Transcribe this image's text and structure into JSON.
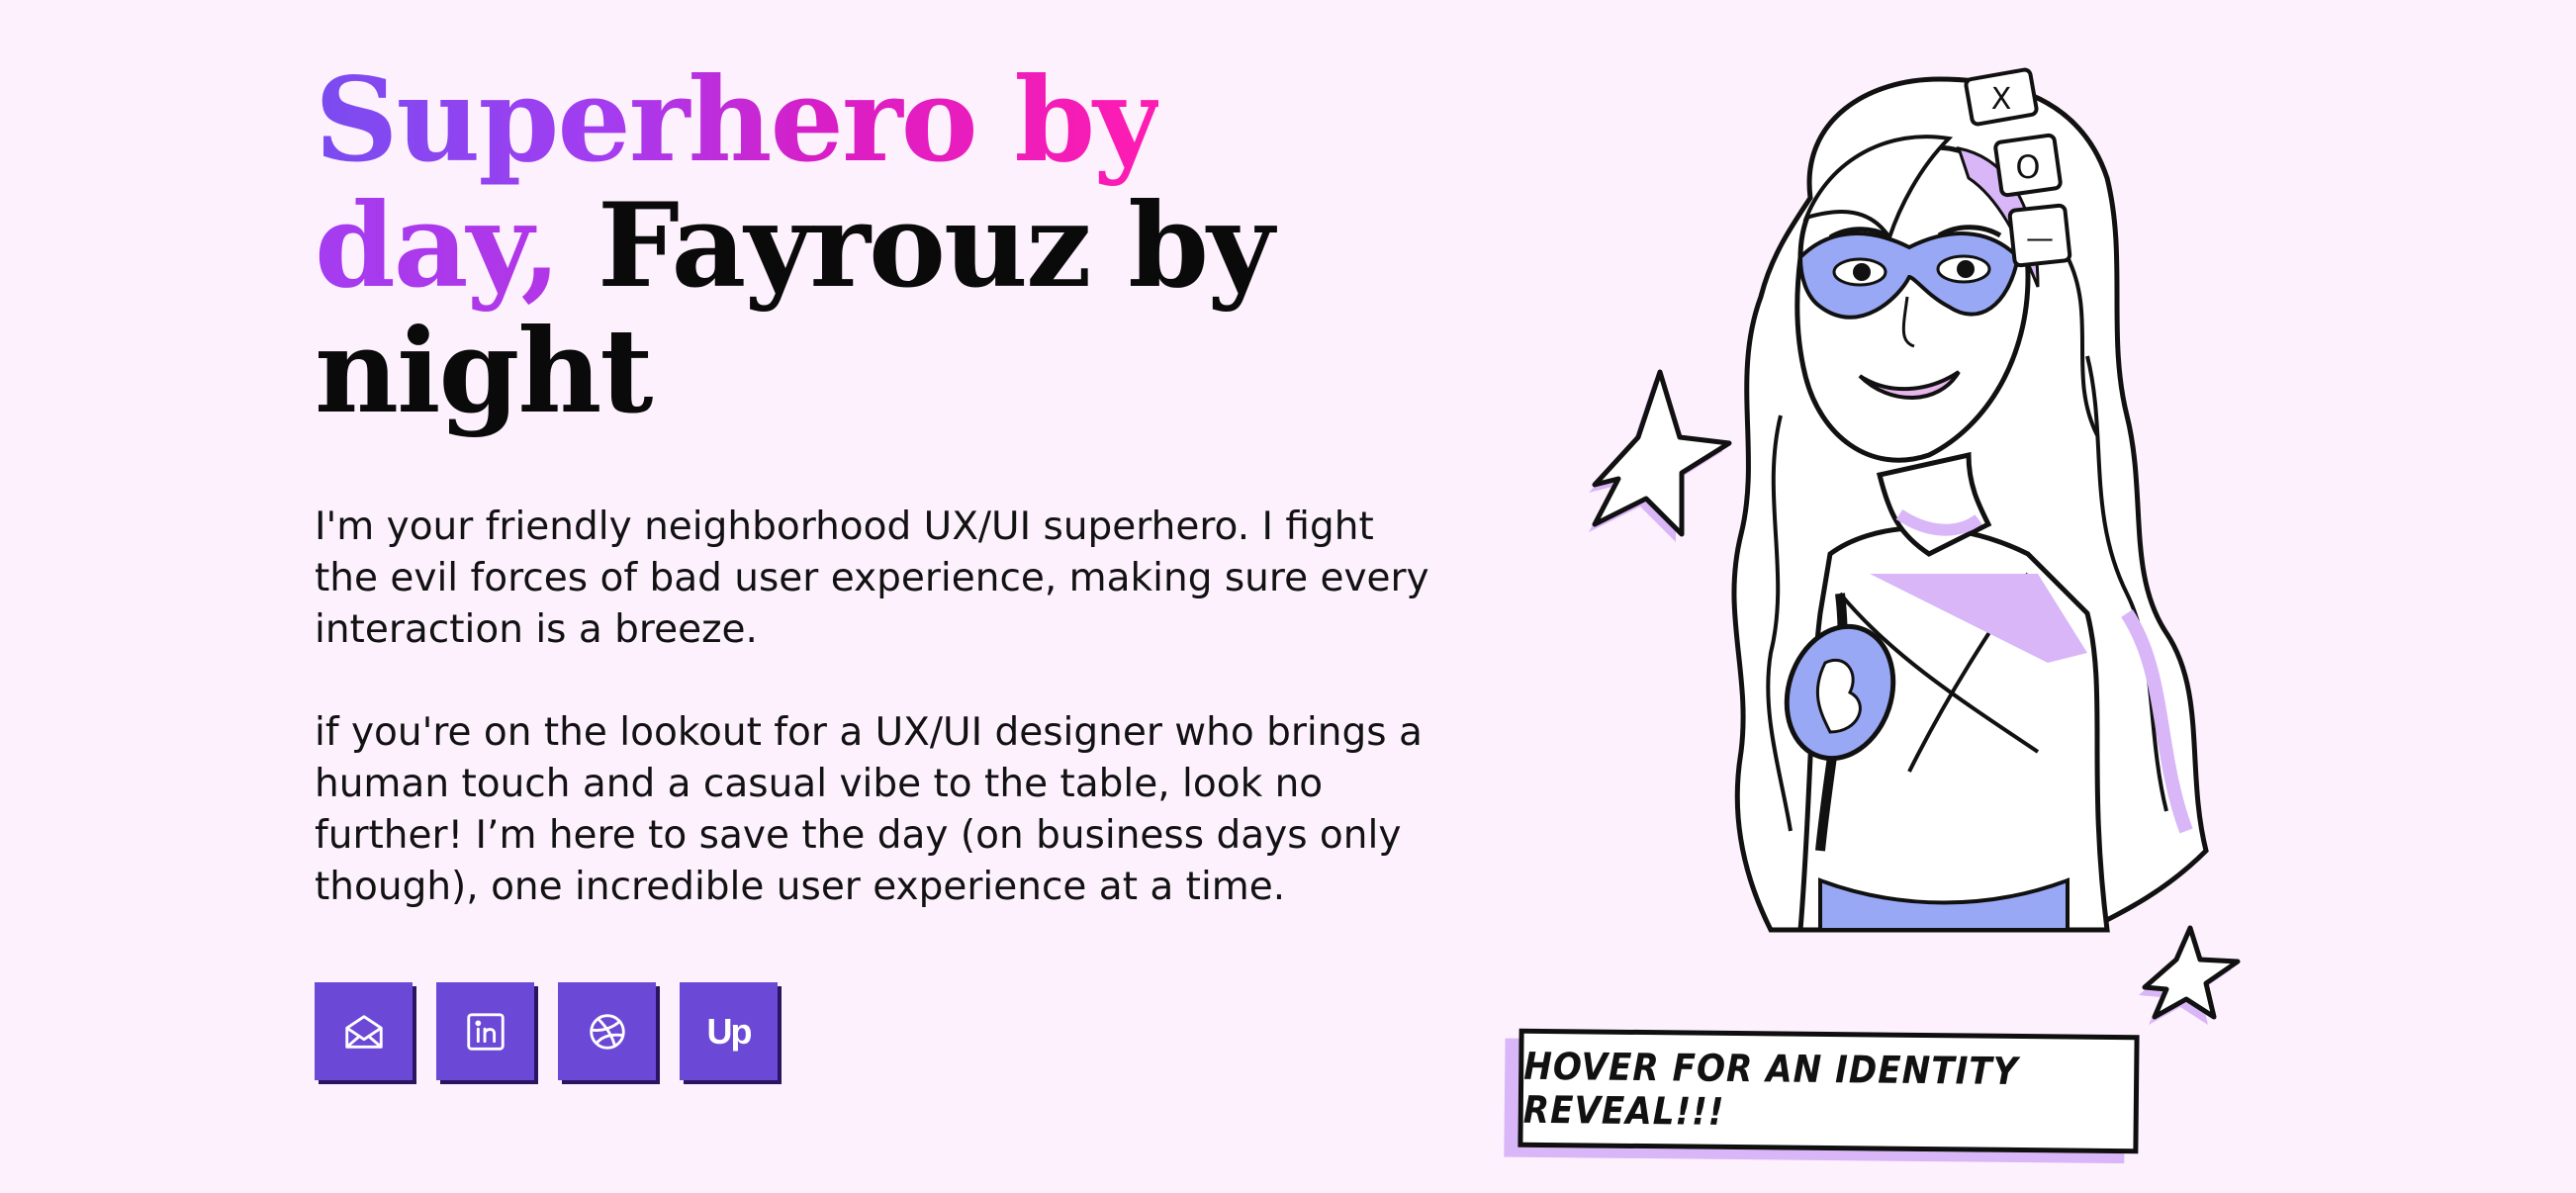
{
  "hero": {
    "title_part1": "Superhero by",
    "title_part2": "day,",
    "title_part3": "Fayrouz by",
    "title_part4": "night",
    "bio_paragraph_1": "I'm your friendly neighborhood UX/UI superhero. I fight the evil forces of bad user experience, making sure every interaction is a breeze.",
    "bio_paragraph_2": "if you're on the lookout for a UX/UI designer who brings a human touch and a casual vibe to the table, look no further! I’m here to save the day (on business days only though), one incredible user experience at a time."
  },
  "socials": {
    "items": [
      {
        "icon": "email-icon"
      },
      {
        "icon": "linkedin-icon"
      },
      {
        "icon": "dribbble-icon"
      },
      {
        "icon": "upwork-icon",
        "text": "Up"
      }
    ],
    "button_color": "#6b48d6"
  },
  "illustration": {
    "badge_text": "HOVER FOR AN IDENTITY REVEAL!!!",
    "hair_tile_x": "X",
    "hair_tile_o": "O",
    "hair_tile_dash": "—"
  },
  "colors": {
    "background": "#fdf1fe",
    "gradient_start": "#7a4cf0",
    "gradient_end": "#ff1cb1",
    "accent_purple": "#d9b6f7",
    "accent_blue": "#98a8f4"
  }
}
